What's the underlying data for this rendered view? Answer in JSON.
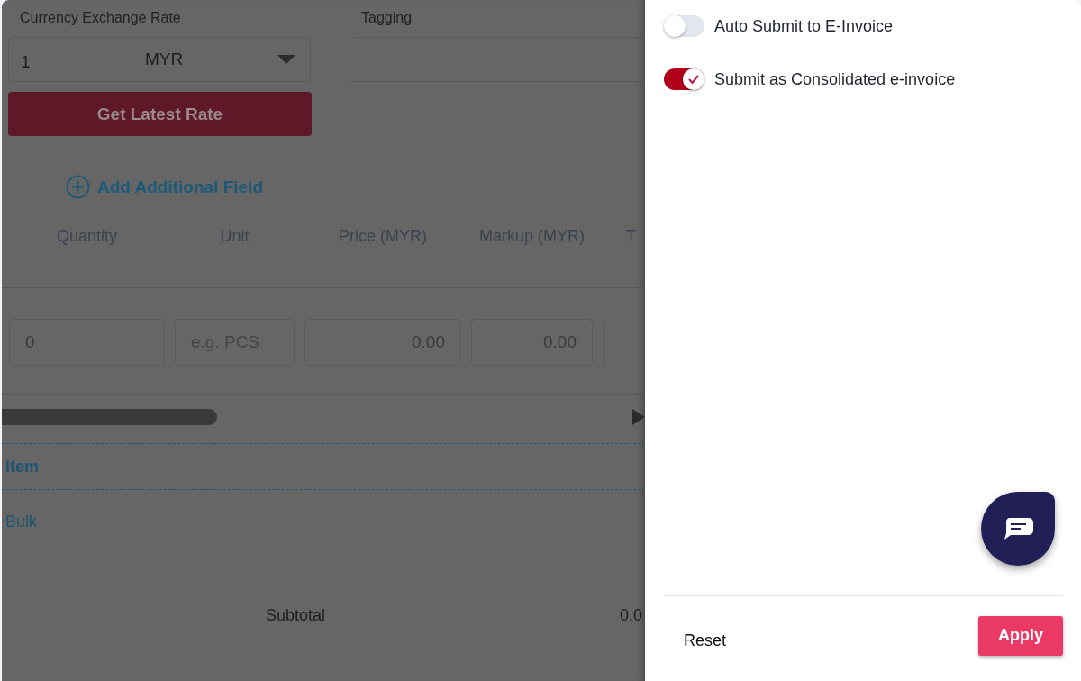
{
  "form": {
    "currency_label": "Currency Exchange Rate",
    "rate_value": "1",
    "currency": "MYR",
    "tagging_label": "Tagging",
    "get_rate_button": "Get Latest Rate",
    "add_field_link": "Add Additional Field"
  },
  "table": {
    "columns": [
      "Quantity",
      "Unit",
      "Price (MYR)",
      "Markup (MYR)",
      "T"
    ],
    "inputs": [
      {
        "kind": "value",
        "text": "0"
      },
      {
        "kind": "placeholder",
        "text": "e.g. PCS"
      },
      {
        "kind": "amount",
        "text": "0.00"
      },
      {
        "kind": "amount",
        "text": "0.00"
      },
      {
        "kind": "empty"
      }
    ]
  },
  "sections": [
    {
      "kind": "header",
      "label": "Item"
    },
    {
      "kind": "link",
      "label": "Bulk"
    }
  ],
  "subtotal": {
    "label": "Subtotal",
    "value": "0.0"
  },
  "panel": {
    "toggles": [
      {
        "label": "Auto Submit to E-Invoice",
        "on": false
      },
      {
        "label": "Submit as Consolidated e-invoice",
        "on": true
      }
    ],
    "reset": "Reset",
    "apply": "Apply"
  }
}
